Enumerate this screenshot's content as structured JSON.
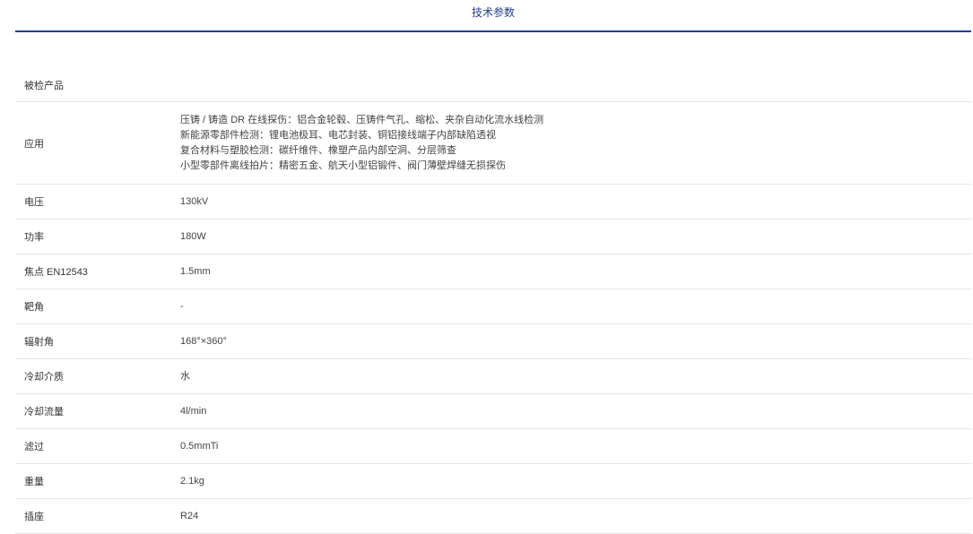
{
  "tab": {
    "title": "技术参数"
  },
  "specs": {
    "product": {
      "label": "被检产品",
      "value": ""
    },
    "application": {
      "label": "应用",
      "lines": [
        "压铸 / 铸造 DR 在线探伤：铝合金轮毂、压铸件气孔、缩松、夹杂自动化流水线检测",
        "新能源零部件检测：锂电池极耳、电芯封装、铜铝接线端子内部缺陷透视",
        "复合材料与塑胶检测：碳纤维件、橡塑产品内部空洞、分层筛查",
        "小型零部件离线拍片：精密五金、航天小型铝锻件、阀门薄壁焊缝无损探伤"
      ]
    },
    "rows": [
      {
        "label": "电压",
        "value": "130kV"
      },
      {
        "label": "功率",
        "value": "180W"
      },
      {
        "label": "焦点 EN12543",
        "value": "1.5mm"
      },
      {
        "label": "靶角",
        "value": "-"
      },
      {
        "label": "辐射角",
        "value": "168°×360°"
      },
      {
        "label": "冷却介质",
        "value": "水"
      },
      {
        "label": "冷却流量",
        "value": "4l/min"
      },
      {
        "label": "滤过",
        "value": "0.5mmTi"
      },
      {
        "label": "重量",
        "value": "2.1kg"
      },
      {
        "label": "插座",
        "value": "R24"
      }
    ]
  }
}
